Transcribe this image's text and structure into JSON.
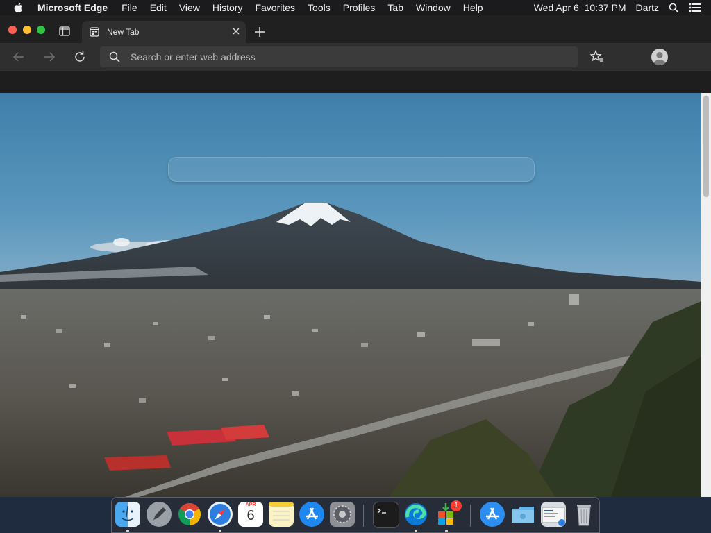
{
  "menubar": {
    "app_name": "Microsoft Edge",
    "items": [
      "File",
      "Edit",
      "View",
      "History",
      "Favorites",
      "Tools",
      "Profiles",
      "Tab",
      "Window",
      "Help"
    ],
    "datetime": "Wed Apr 6  10:37 PM",
    "user": "Dartz"
  },
  "tab": {
    "title": "New Tab"
  },
  "address_bar": {
    "placeholder": "Search or enter web address",
    "value": ""
  },
  "dock": {
    "calendar_month": "APR",
    "calendar_day": "6",
    "badge_count": "1"
  },
  "colors": {
    "close": "#ff5f57",
    "minimize": "#febc2e",
    "maximize": "#28c840",
    "badge": "#ff3b30"
  }
}
